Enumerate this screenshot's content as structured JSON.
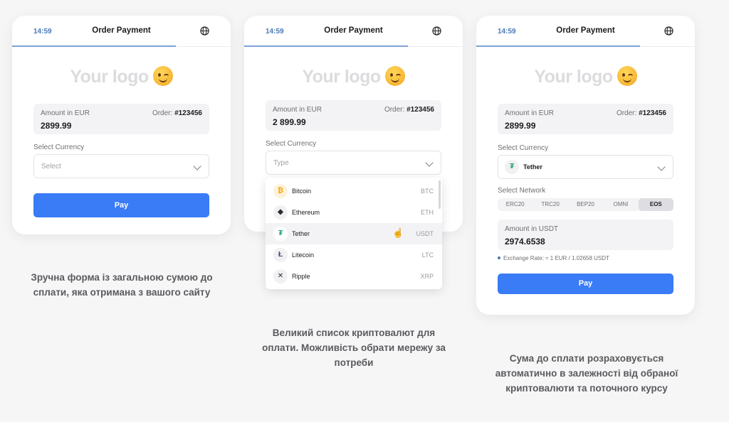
{
  "colors": {
    "accent": "#3a7bf6",
    "time": "#4a78b8",
    "progress": "#7ea0d6",
    "tether": "#26a17b",
    "bitcoin": "#f7a600"
  },
  "screens": [
    {
      "header": {
        "time": "14:59",
        "title": "Order Payment",
        "language_icon": "globe-icon"
      },
      "logo": "Your logo",
      "amount": {
        "label": "Amount in EUR",
        "order_label": "Order:",
        "order_id": "#123456",
        "value": "2899.99"
      },
      "currency": {
        "label": "Select Currency",
        "placeholder": "Select"
      },
      "pay_label": "Pay"
    },
    {
      "header": {
        "time": "14:59",
        "title": "Order Payment",
        "language_icon": "globe-icon"
      },
      "logo": "Your logo",
      "amount": {
        "label": "Amount in EUR",
        "order_label": "Order:",
        "order_id": "#123456",
        "value": "2 899.99"
      },
      "currency": {
        "label": "Select Currency",
        "placeholder": "Type"
      },
      "dropdown": [
        {
          "name": "Bitcoin",
          "symbol": "BTC",
          "icon": "bitcoin-icon",
          "glyph": "₿"
        },
        {
          "name": "Ethereum",
          "symbol": "ETH",
          "icon": "ethereum-icon",
          "glyph": "◆"
        },
        {
          "name": "Tether",
          "symbol": "USDT",
          "icon": "tether-icon",
          "glyph": "₮"
        },
        {
          "name": "Litecoin",
          "symbol": "LTC",
          "icon": "litecoin-icon",
          "glyph": "Ł"
        },
        {
          "name": "Ripple",
          "symbol": "XRP",
          "icon": "ripple-icon",
          "glyph": "✕"
        }
      ],
      "hovered": "Tether"
    },
    {
      "header": {
        "time": "14:59",
        "title": "Order Payment",
        "language_icon": "globe-icon"
      },
      "logo": "Your logo",
      "amount": {
        "label": "Amount in EUR",
        "order_label": "Order:",
        "order_id": "#123456",
        "value": "2899.99"
      },
      "currency": {
        "label": "Select Currency",
        "selected": "Tether",
        "glyph": "₮"
      },
      "network": {
        "label": "Select Network",
        "options": [
          "ERC20",
          "TRC20",
          "BEP20",
          "OMNI",
          "EOS"
        ],
        "selected": "EOS"
      },
      "converted": {
        "label": "Amount in USDT",
        "value": "2974.6538"
      },
      "rate": "Exchange Rate: ≈ 1 EUR / 1.02658 USDT",
      "pay_label": "Pay"
    }
  ],
  "captions": [
    "Зручна форма із загальною сумою до сплати, яка отримана з вашого сайту",
    "Великий список криптовалют для оплати. Можливість обрати мережу за потреби",
    "Сума до сплати розраховується автоматично в залежності від обраної криптовалюти та поточного курсу"
  ]
}
